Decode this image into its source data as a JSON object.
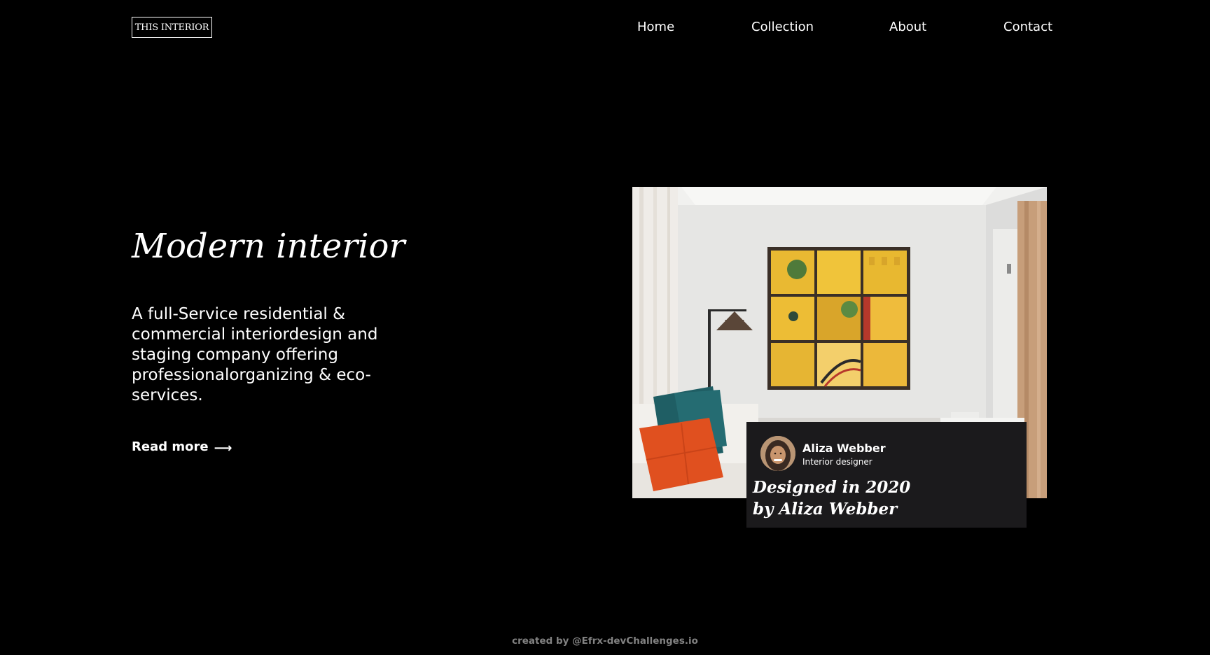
{
  "header": {
    "logo": "THIS INTERIOR",
    "nav": [
      {
        "label": "Home"
      },
      {
        "label": "Collection"
      },
      {
        "label": "About"
      },
      {
        "label": "Contact"
      }
    ]
  },
  "hero": {
    "title": "Modern interior",
    "description": "A full-Service residential & commercial interiordesign and staging company offering professionalorganizing & eco-services.",
    "read_more": "Read more",
    "arrow_icon": "arrow-right-icon"
  },
  "card": {
    "designer_name": "Aliza Webber",
    "designer_role": "Interior designer",
    "caption": "Designed in 2020 by Aliza Webber"
  },
  "footer": {
    "credit": "created by @Efrx-devChallenges.io"
  },
  "colors": {
    "background": "#000000",
    "text": "#ffffff",
    "card": "#1b1a1c",
    "footer_text": "#828282"
  }
}
